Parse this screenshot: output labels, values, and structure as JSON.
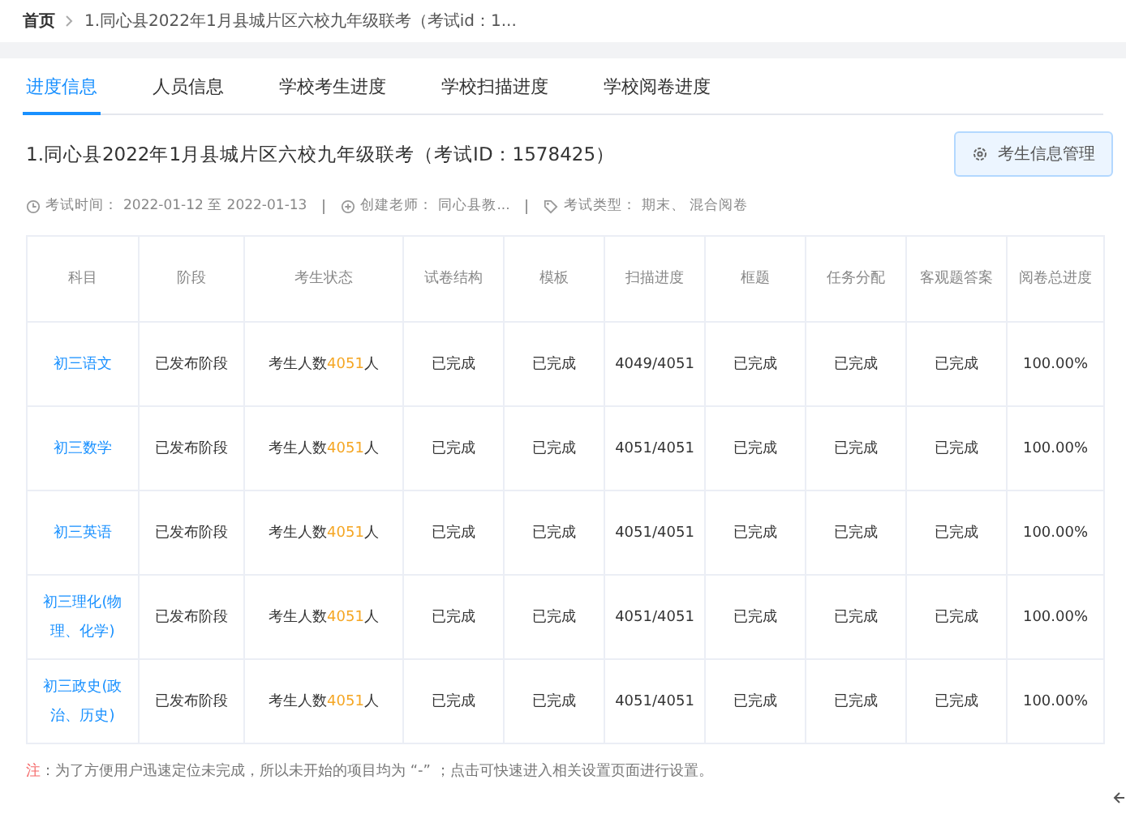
{
  "breadcrumb": {
    "home": "首页",
    "current": "1.同心县2022年1月县城片区六校九年级联考（考试id：1..."
  },
  "tabs": [
    {
      "label": "进度信息",
      "selected": true
    },
    {
      "label": "人员信息",
      "selected": false
    },
    {
      "label": "学校考生进度",
      "selected": false
    },
    {
      "label": "学校扫描进度",
      "selected": false
    },
    {
      "label": "学校阅卷进度",
      "selected": false
    }
  ],
  "exam": {
    "title": "1.同心县2022年1月县城片区六校九年级联考（考试ID：1578425）",
    "manage_button": "考生信息管理",
    "meta": [
      {
        "kind": "time",
        "label": "考试时间：",
        "value": "2022-01-12  至  2022-01-13"
      },
      {
        "kind": "creator",
        "label": "创建老师：",
        "value": "同心县教..."
      },
      {
        "kind": "type",
        "label": "考试类型：",
        "value": "期末、 混合阅卷"
      }
    ]
  },
  "table": {
    "columns": [
      "科目",
      "阶段",
      "考生状态",
      "试卷结构",
      "模板",
      "扫描进度",
      "框题",
      "任务分配",
      "客观题答案",
      "阅卷总进度"
    ],
    "rows": [
      {
        "subject": "初三语文",
        "stage": "已发布阶段",
        "status_prefix": "考生人数",
        "status_count": "4051",
        "status_suffix": "人",
        "structure": "已完成",
        "template": "已完成",
        "scan": "4049/4051",
        "frame": "已完成",
        "tasks": "已完成",
        "answers": "已完成",
        "progress": "100.00%"
      },
      {
        "subject": "初三数学",
        "stage": "已发布阶段",
        "status_prefix": "考生人数",
        "status_count": "4051",
        "status_suffix": "人",
        "structure": "已完成",
        "template": "已完成",
        "scan": "4051/4051",
        "frame": "已完成",
        "tasks": "已完成",
        "answers": "已完成",
        "progress": "100.00%"
      },
      {
        "subject": "初三英语",
        "stage": "已发布阶段",
        "status_prefix": "考生人数",
        "status_count": "4051",
        "status_suffix": "人",
        "structure": "已完成",
        "template": "已完成",
        "scan": "4051/4051",
        "frame": "已完成",
        "tasks": "已完成",
        "answers": "已完成",
        "progress": "100.00%"
      },
      {
        "subject": "初三理化(物理、化学)",
        "stage": "已发布阶段",
        "status_prefix": "考生人数",
        "status_count": "4051",
        "status_suffix": "人",
        "structure": "已完成",
        "template": "已完成",
        "scan": "4051/4051",
        "frame": "已完成",
        "tasks": "已完成",
        "answers": "已完成",
        "progress": "100.00%"
      },
      {
        "subject": "初三政史(政治、历史)",
        "stage": "已发布阶段",
        "status_prefix": "考生人数",
        "status_count": "4051",
        "status_suffix": "人",
        "structure": "已完成",
        "template": "已完成",
        "scan": "4051/4051",
        "frame": "已完成",
        "tasks": "已完成",
        "answers": "已完成",
        "progress": "100.00%"
      }
    ]
  },
  "note": {
    "label": "注",
    "text": "：为了方便用户迅速定位未完成，所以未开始的项目均为 “-” ；点击可快速进入相关设置页面进行设置。"
  }
}
